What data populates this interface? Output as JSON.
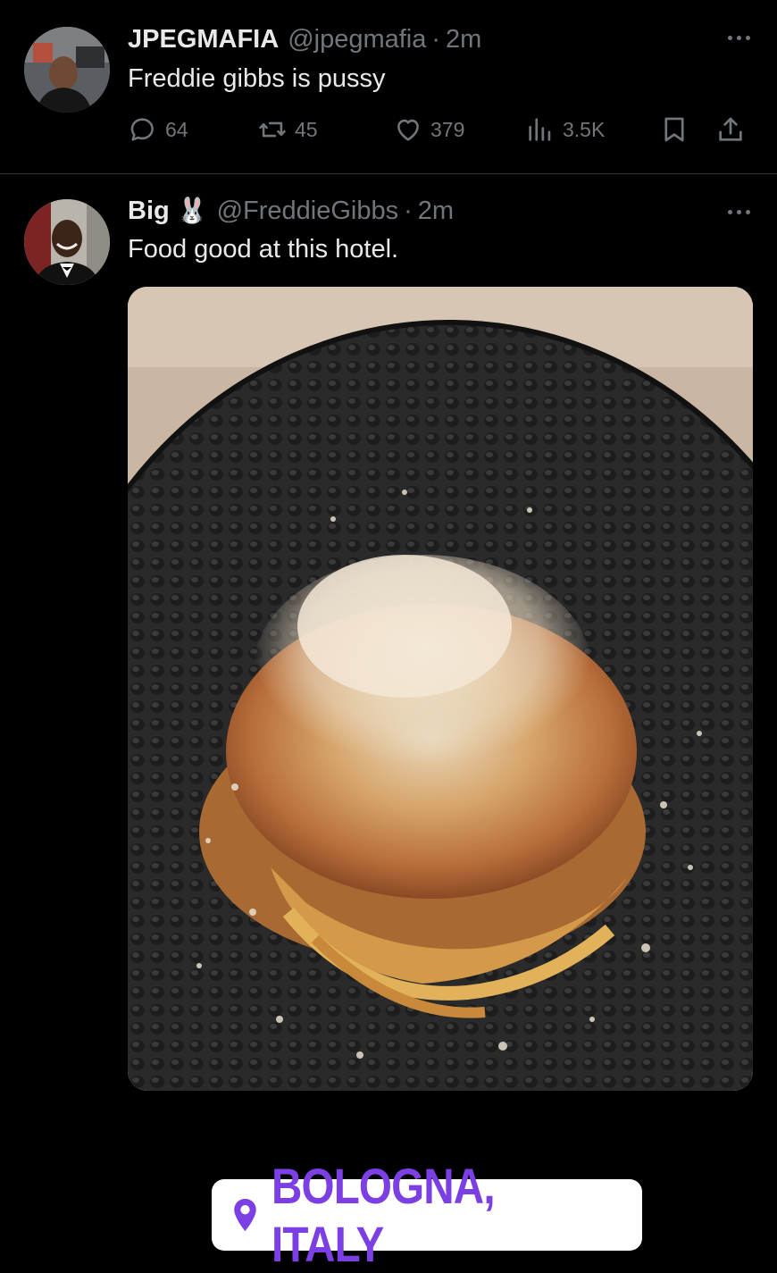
{
  "tweets": [
    {
      "name": "JPEGMAFIA",
      "handle": "@jpegmafia",
      "separator": "·",
      "time": "2m",
      "text": "Freddie gibbs is pussy",
      "stats": {
        "replies": "64",
        "retweets": "45",
        "likes": "379",
        "views": "3.5K"
      }
    },
    {
      "name": "Big",
      "name_emoji": "🐰",
      "handle": "@FreddieGibbs",
      "separator": "·",
      "time": "2m",
      "text": "Food good at this hotel.",
      "media": {
        "description_icon": "photo-pasta",
        "location_sticker": "BOLOGNA, ITALY"
      }
    }
  ],
  "colors": {
    "background": "#000000",
    "text_primary": "#e7e9ea",
    "text_secondary": "#71767b",
    "divider": "#2f3336",
    "location_accent": "#7b3fe4"
  }
}
